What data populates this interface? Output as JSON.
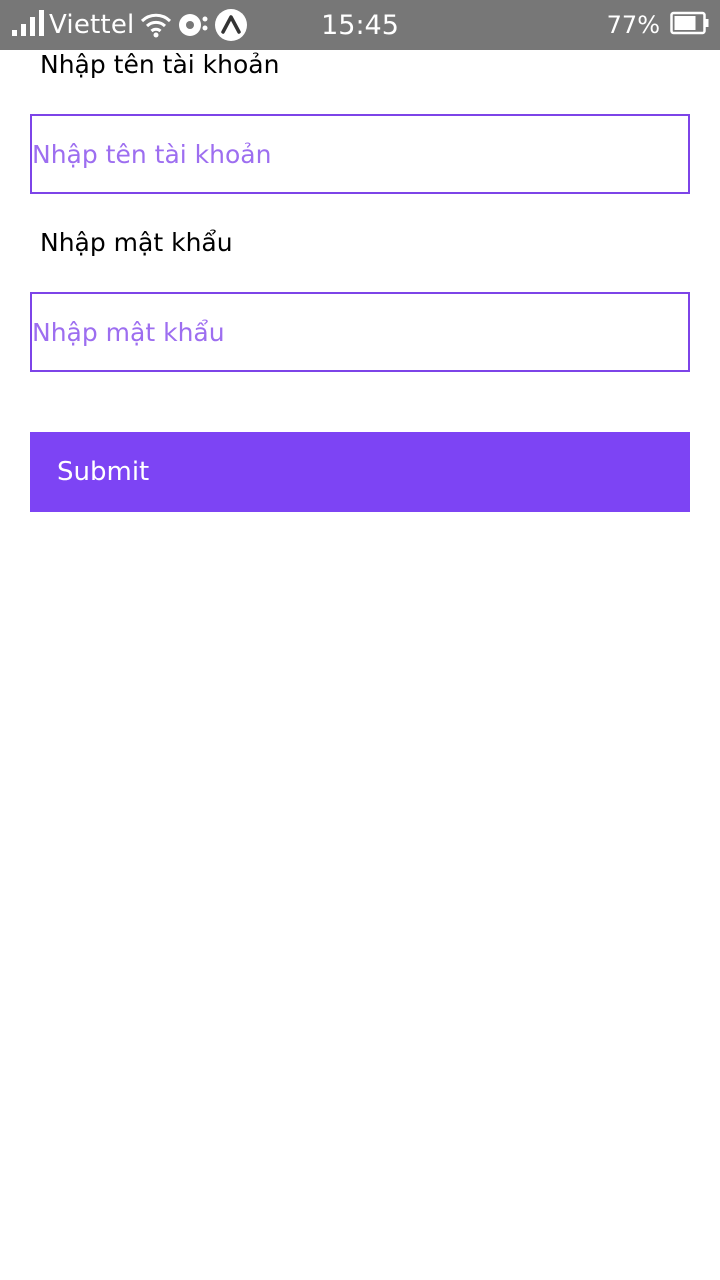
{
  "status_bar": {
    "carrier": "Viettel",
    "time": "15:45",
    "battery": "77%",
    "icons": [
      "signal-icon",
      "wifi-icon",
      "sync-icon",
      "expo-app-icon",
      "battery-icon"
    ]
  },
  "form": {
    "username_label": "Nhập tên tài khoản",
    "username_placeholder": "Nhập tên tài khoản",
    "password_label": "Nhập mật khẩu",
    "password_placeholder": "Nhập mật khẩu",
    "submit_label": "Submit"
  },
  "colors": {
    "accent": "#7d44f4",
    "input_border": "#7d44e8",
    "placeholder": "#9d6ef0",
    "status_bar_bg": "#777777"
  }
}
